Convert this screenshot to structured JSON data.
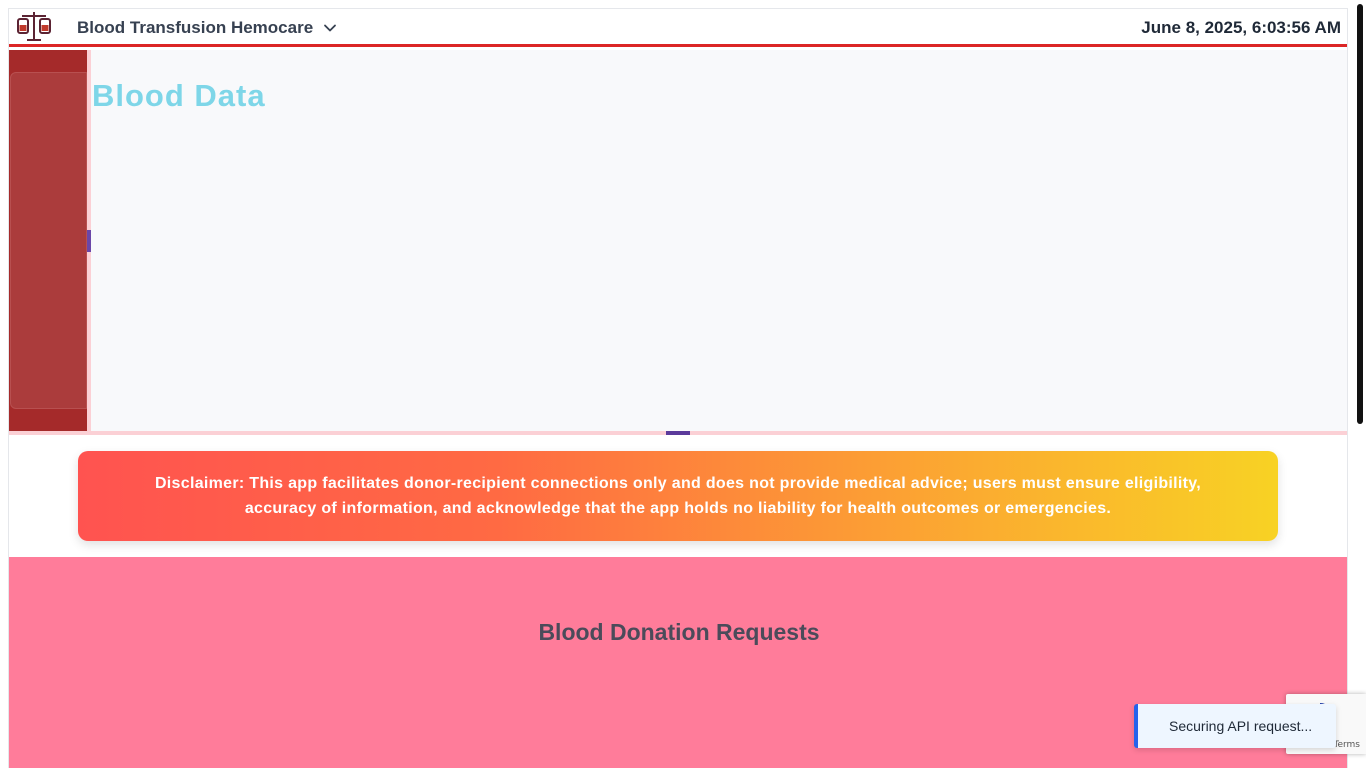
{
  "header": {
    "brand": "Blood Transfusion Hemocare",
    "datetime": "June 8, 2025, 6:03:56 AM",
    "logo_icon": "blood-bag-scale-icon",
    "dropdown_icon": "chevron-down-icon"
  },
  "hero": {
    "title": "Blood Data"
  },
  "disclaimer": {
    "text": "Disclaimer: This app facilitates donor-recipient connections only and does not provide medical advice; users must ensure eligibility, accuracy of information, and acknowledge that the app holds no liability for health outcomes or emergencies."
  },
  "requests": {
    "title": "Blood Donation Requests"
  },
  "toast": {
    "text": "Securing API request..."
  },
  "recaptcha": {
    "terms": "Terms"
  },
  "colors": {
    "accent": "#dc2626",
    "sidebar": "#a52a2a",
    "hero_title": "#7ed6e8",
    "requests_bg": "#ff7c9a",
    "toast_border": "#2563eb"
  }
}
